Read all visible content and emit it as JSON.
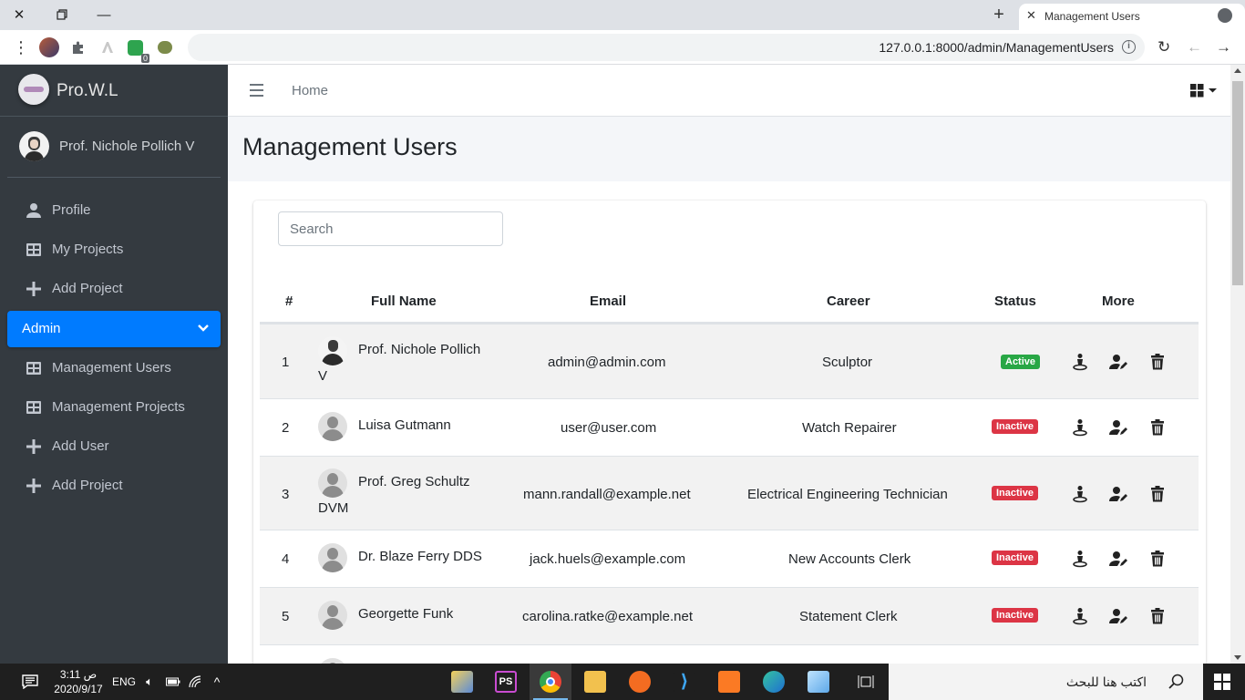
{
  "browser": {
    "tab_title": "Management Users",
    "url": "127.0.0.1:8000/admin/ManagementUsers",
    "extension_badge": "0"
  },
  "sidebar": {
    "brand": "Pro.W.L",
    "user_name": "Prof. Nichole Pollich V",
    "items": [
      {
        "label": "Profile",
        "icon": "user-icon"
      },
      {
        "label": "My Projects",
        "icon": "table-icon"
      },
      {
        "label": "Add Project",
        "icon": "plus-icon"
      },
      {
        "label": "Admin",
        "icon": "chevron-down-icon",
        "active": true
      },
      {
        "label": "Management Users",
        "icon": "table-icon"
      },
      {
        "label": "Management Projects",
        "icon": "table-icon"
      },
      {
        "label": "Add User",
        "icon": "plus-icon"
      },
      {
        "label": "Add Project",
        "icon": "plus-icon"
      }
    ]
  },
  "topnav": {
    "home": "Home"
  },
  "page": {
    "title": "Management Users",
    "search_placeholder": "Search"
  },
  "table": {
    "headers": [
      "#",
      "Full Name",
      "Email",
      "Career",
      "Status",
      "More"
    ],
    "rows": [
      {
        "n": "1",
        "name1": "Prof. Nichole Pollich",
        "name2": "V",
        "email": "admin@admin.com",
        "career": "Sculptor",
        "status": "Active"
      },
      {
        "n": "2",
        "name1": "Luisa Gutmann",
        "name2": "",
        "email": "user@user.com",
        "career": "Watch Repairer",
        "status": "Inactive"
      },
      {
        "n": "3",
        "name1": "Prof. Greg Schultz",
        "name2": "DVM",
        "email": "mann.randall@example.net",
        "career": "Electrical Engineering Technician",
        "status": "Inactive"
      },
      {
        "n": "4",
        "name1": "Dr. Blaze Ferry DDS",
        "name2": "",
        "email": "jack.huels@example.com",
        "career": "New Accounts Clerk",
        "status": "Inactive"
      },
      {
        "n": "5",
        "name1": "Georgette Funk",
        "name2": "",
        "email": "carolina.ratke@example.net",
        "career": "Statement Clerk",
        "status": "Inactive"
      }
    ]
  },
  "taskbar": {
    "time": "3:11 ص",
    "date": "2020/9/17",
    "lang": "ENG",
    "search_text": "اكتب هنا للبحث"
  },
  "colors": {
    "sidebar_bg": "#343a40",
    "primary": "#007bff",
    "active_badge": "#28a745",
    "inactive_badge": "#dc3545"
  }
}
